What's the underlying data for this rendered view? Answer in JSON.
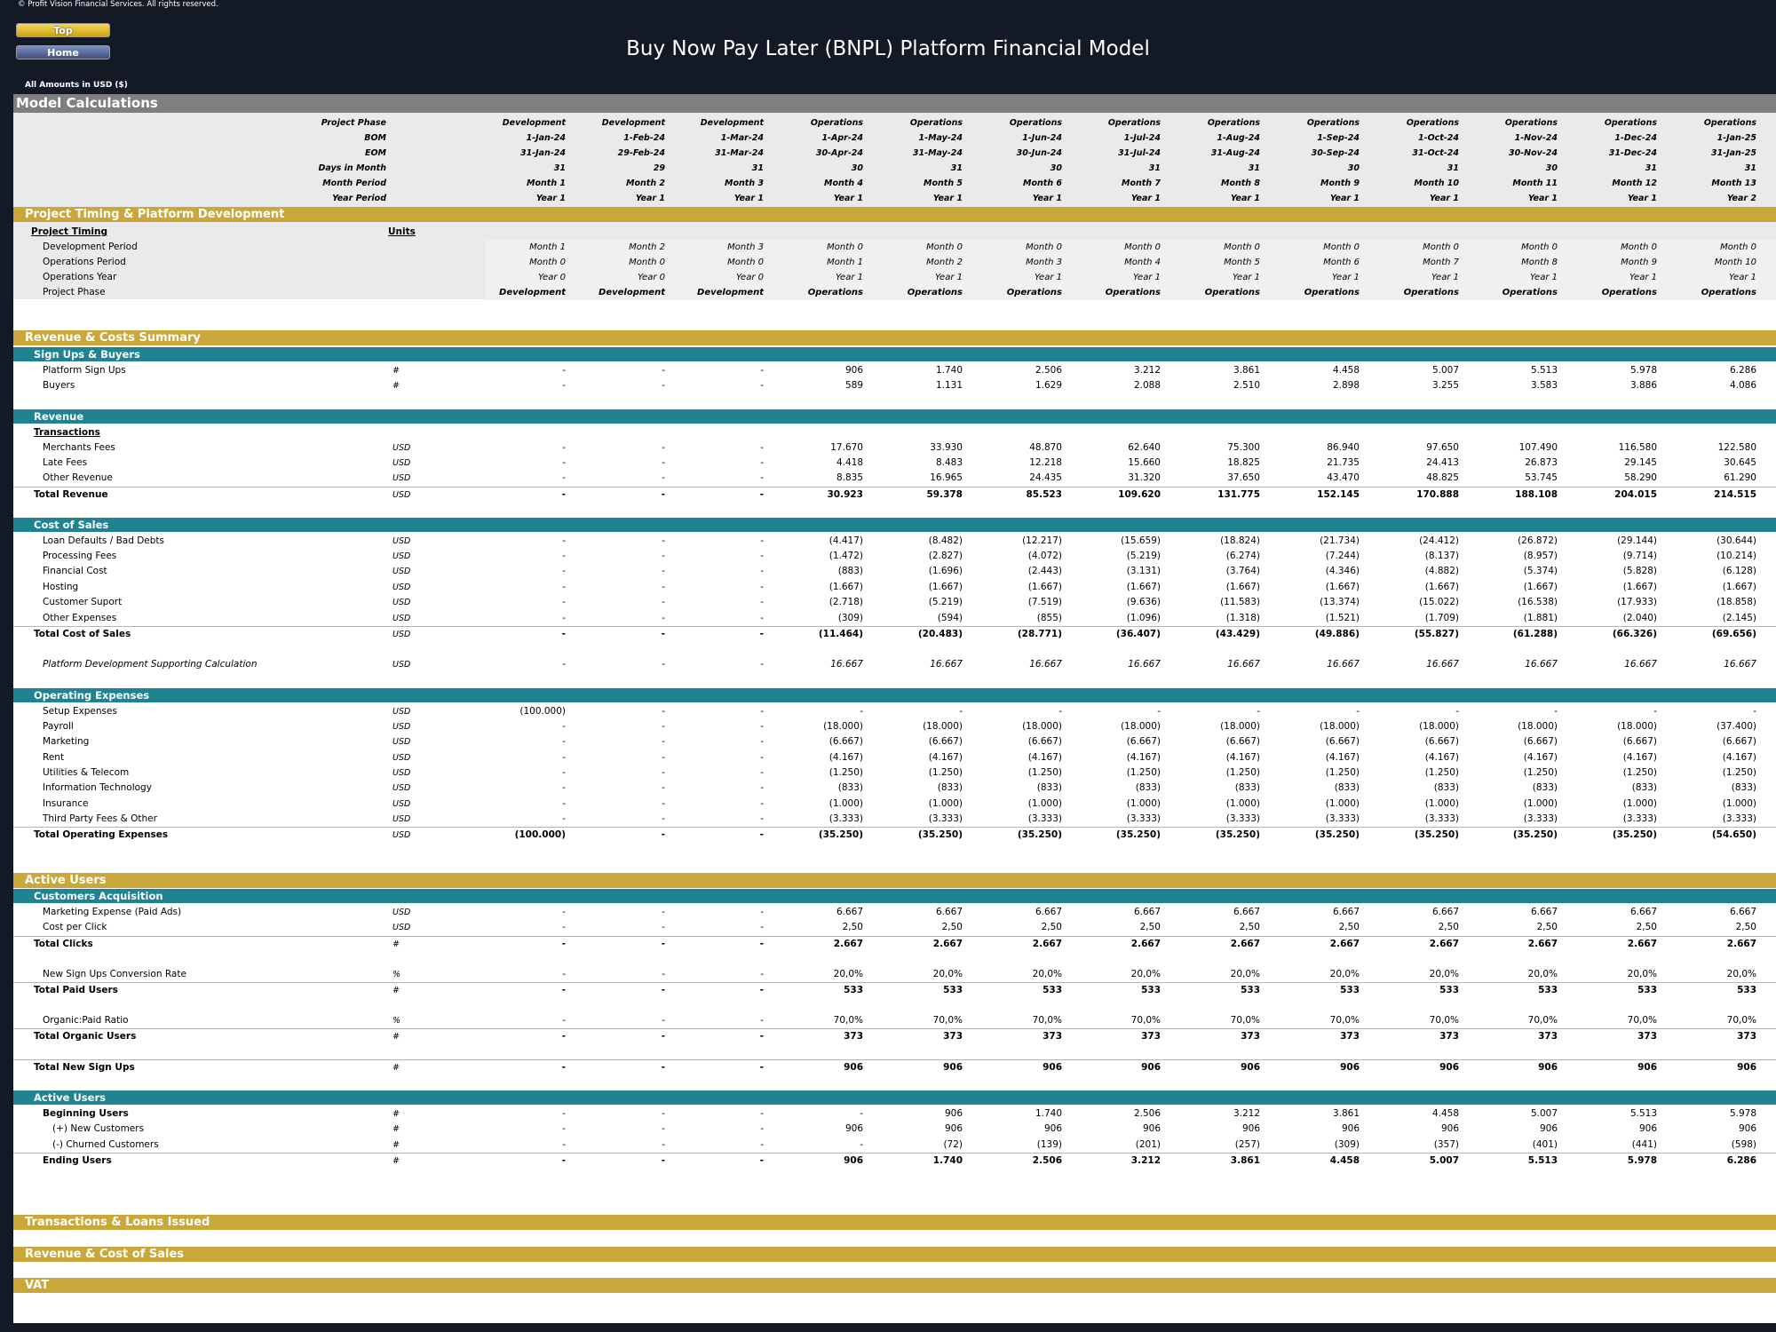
{
  "copyright": "© Profit Vision Financial Services. All rights reserved.",
  "nav": {
    "top": "Top",
    "home": "Home"
  },
  "title": "Buy Now Pay Later (BNPL) Platform Financial Model",
  "amounts": "All Amounts in  USD ($)",
  "section_title": "Model Calculations",
  "header_rows": [
    {
      "label": "Project Phase",
      "values": [
        "Development",
        "Development",
        "Development",
        "Operations",
        "Operations",
        "Operations",
        "Operations",
        "Operations",
        "Operations",
        "Operations",
        "Operations",
        "Operations",
        "Operations"
      ]
    },
    {
      "label": "BOM",
      "values": [
        "1-Jan-24",
        "1-Feb-24",
        "1-Mar-24",
        "1-Apr-24",
        "1-May-24",
        "1-Jun-24",
        "1-Jul-24",
        "1-Aug-24",
        "1-Sep-24",
        "1-Oct-24",
        "1-Nov-24",
        "1-Dec-24",
        "1-Jan-25"
      ]
    },
    {
      "label": "EOM",
      "values": [
        "31-Jan-24",
        "29-Feb-24",
        "31-Mar-24",
        "30-Apr-24",
        "31-May-24",
        "30-Jun-24",
        "31-Jul-24",
        "31-Aug-24",
        "30-Sep-24",
        "31-Oct-24",
        "30-Nov-24",
        "31-Dec-24",
        "31-Jan-25"
      ]
    },
    {
      "label": "Days in Month",
      "values": [
        "31",
        "29",
        "31",
        "30",
        "31",
        "30",
        "31",
        "31",
        "30",
        "31",
        "30",
        "31",
        "31"
      ]
    },
    {
      "label": "Month Period",
      "values": [
        "Month 1",
        "Month 2",
        "Month 3",
        "Month 4",
        "Month 5",
        "Month 6",
        "Month 7",
        "Month 8",
        "Month 9",
        "Month 10",
        "Month 11",
        "Month 12",
        "Month 13"
      ]
    },
    {
      "label": "Year Period",
      "values": [
        "Year 1",
        "Year 1",
        "Year 1",
        "Year 1",
        "Year 1",
        "Year 1",
        "Year 1",
        "Year 1",
        "Year 1",
        "Year 1",
        "Year 1",
        "Year 1",
        "Year 2"
      ]
    }
  ],
  "gold_sections": {
    "timing": "Project Timing & Platform Development",
    "summary": "Revenue & Costs Summary",
    "active": "Active Users",
    "transactions": "Transactions & Loans Issued",
    "revcost": "Revenue & Cost of Sales",
    "vat": "VAT"
  },
  "teal_sections": {
    "signups": "Sign Ups & Buyers",
    "revenue": "Revenue",
    "cos": "Cost of Sales",
    "opex": "Operating Expenses",
    "acq": "Customers Acquisition",
    "active": "Active Users"
  },
  "timing": {
    "heading": "Project Timing",
    "units_heading": "Units",
    "rows": [
      {
        "label": "Development Period",
        "values": [
          "Month 1",
          "Month 2",
          "Month 3",
          "Month 0",
          "Month 0",
          "Month 0",
          "Month 0",
          "Month 0",
          "Month 0",
          "Month 0",
          "Month 0",
          "Month 0",
          "Month 0"
        ]
      },
      {
        "label": "Operations Period",
        "values": [
          "Month 0",
          "Month 0",
          "Month 0",
          "Month 1",
          "Month 2",
          "Month 3",
          "Month 4",
          "Month 5",
          "Month 6",
          "Month 7",
          "Month 8",
          "Month 9",
          "Month 10"
        ]
      },
      {
        "label": "Operations Year",
        "values": [
          "Year 0",
          "Year 0",
          "Year 0",
          "Year 1",
          "Year 1",
          "Year 1",
          "Year 1",
          "Year 1",
          "Year 1",
          "Year 1",
          "Year 1",
          "Year 1",
          "Year 1"
        ]
      },
      {
        "label": "Project Phase",
        "values": [
          "Development",
          "Development",
          "Development",
          "Operations",
          "Operations",
          "Operations",
          "Operations",
          "Operations",
          "Operations",
          "Operations",
          "Operations",
          "Operations",
          "Operations"
        ]
      }
    ]
  },
  "signups": [
    {
      "label": "Platform Sign Ups",
      "unit": "#",
      "values": [
        "-",
        "-",
        "-",
        "906",
        "1.740",
        "2.506",
        "3.212",
        "3.861",
        "4.458",
        "5.007",
        "5.513",
        "5.978",
        "6.286"
      ]
    },
    {
      "label": "Buyers",
      "unit": "#",
      "values": [
        "-",
        "-",
        "-",
        "589",
        "1.131",
        "1.629",
        "2.088",
        "2.510",
        "2.898",
        "3.255",
        "3.583",
        "3.886",
        "4.086"
      ]
    }
  ],
  "transactions_heading": "Transactions",
  "revenue": [
    {
      "label": "Merchants Fees",
      "unit": "USD",
      "values": [
        "-",
        "-",
        "-",
        "17.670",
        "33.930",
        "48.870",
        "62.640",
        "75.300",
        "86.940",
        "97.650",
        "107.490",
        "116.580",
        "122.580"
      ]
    },
    {
      "label": "Late Fees",
      "unit": "USD",
      "values": [
        "-",
        "-",
        "-",
        "4.418",
        "8.483",
        "12.218",
        "15.660",
        "18.825",
        "21.735",
        "24.413",
        "26.873",
        "29.145",
        "30.645"
      ]
    },
    {
      "label": "Other Revenue",
      "unit": "USD",
      "values": [
        "-",
        "-",
        "-",
        "8.835",
        "16.965",
        "24.435",
        "31.320",
        "37.650",
        "43.470",
        "48.825",
        "53.745",
        "58.290",
        "61.290"
      ]
    }
  ],
  "total_revenue": {
    "label": "Total Revenue",
    "unit": "USD",
    "values": [
      "-",
      "-",
      "-",
      "30.923",
      "59.378",
      "85.523",
      "109.620",
      "131.775",
      "152.145",
      "170.888",
      "188.108",
      "204.015",
      "214.515"
    ]
  },
  "cos": [
    {
      "label": "Loan Defaults / Bad Debts",
      "unit": "USD",
      "values": [
        "-",
        "-",
        "-",
        "(4.417)",
        "(8.482)",
        "(12.217)",
        "(15.659)",
        "(18.824)",
        "(21.734)",
        "(24.412)",
        "(26.872)",
        "(29.144)",
        "(30.644)"
      ]
    },
    {
      "label": "Processing Fees",
      "unit": "USD",
      "values": [
        "-",
        "-",
        "-",
        "(1.472)",
        "(2.827)",
        "(4.072)",
        "(5.219)",
        "(6.274)",
        "(7.244)",
        "(8.137)",
        "(8.957)",
        "(9.714)",
        "(10.214)"
      ]
    },
    {
      "label": "Financial Cost",
      "unit": "USD",
      "values": [
        "-",
        "-",
        "-",
        "(883)",
        "(1.696)",
        "(2.443)",
        "(3.131)",
        "(3.764)",
        "(4.346)",
        "(4.882)",
        "(5.374)",
        "(5.828)",
        "(6.128)"
      ]
    },
    {
      "label": "Hosting",
      "unit": "USD",
      "values": [
        "-",
        "-",
        "-",
        "(1.667)",
        "(1.667)",
        "(1.667)",
        "(1.667)",
        "(1.667)",
        "(1.667)",
        "(1.667)",
        "(1.667)",
        "(1.667)",
        "(1.667)"
      ]
    },
    {
      "label": "Customer Suport",
      "unit": "USD",
      "values": [
        "-",
        "-",
        "-",
        "(2.718)",
        "(5.219)",
        "(7.519)",
        "(9.636)",
        "(11.583)",
        "(13.374)",
        "(15.022)",
        "(16.538)",
        "(17.933)",
        "(18.858)"
      ]
    },
    {
      "label": "Other Expenses",
      "unit": "USD",
      "values": [
        "-",
        "-",
        "-",
        "(309)",
        "(594)",
        "(855)",
        "(1.096)",
        "(1.318)",
        "(1.521)",
        "(1.709)",
        "(1.881)",
        "(2.040)",
        "(2.145)"
      ]
    }
  ],
  "total_cos": {
    "label": "Total Cost of Sales",
    "unit": "USD",
    "values": [
      "-",
      "-",
      "-",
      "(11.464)",
      "(20.483)",
      "(28.771)",
      "(36.407)",
      "(43.429)",
      "(49.886)",
      "(55.827)",
      "(61.288)",
      "(66.326)",
      "(69.656)"
    ]
  },
  "platform_dev": {
    "label": "Platform Development Supporting Calculation",
    "unit": "USD",
    "values": [
      "-",
      "-",
      "-",
      "16.667",
      "16.667",
      "16.667",
      "16.667",
      "16.667",
      "16.667",
      "16.667",
      "16.667",
      "16.667",
      "16.667"
    ]
  },
  "opex": [
    {
      "label": "Setup Expenses",
      "unit": "USD",
      "values": [
        "(100.000)",
        "-",
        "-",
        "-",
        "-",
        "-",
        "-",
        "-",
        "-",
        "-",
        "-",
        "-",
        "-"
      ]
    },
    {
      "label": "Payroll",
      "unit": "USD",
      "values": [
        "-",
        "-",
        "-",
        "(18.000)",
        "(18.000)",
        "(18.000)",
        "(18.000)",
        "(18.000)",
        "(18.000)",
        "(18.000)",
        "(18.000)",
        "(18.000)",
        "(37.400)"
      ]
    },
    {
      "label": "Marketing",
      "unit": "USD",
      "values": [
        "-",
        "-",
        "-",
        "(6.667)",
        "(6.667)",
        "(6.667)",
        "(6.667)",
        "(6.667)",
        "(6.667)",
        "(6.667)",
        "(6.667)",
        "(6.667)",
        "(6.667)"
      ]
    },
    {
      "label": "Rent",
      "unit": "USD",
      "values": [
        "-",
        "-",
        "-",
        "(4.167)",
        "(4.167)",
        "(4.167)",
        "(4.167)",
        "(4.167)",
        "(4.167)",
        "(4.167)",
        "(4.167)",
        "(4.167)",
        "(4.167)"
      ]
    },
    {
      "label": "Utilities & Telecom",
      "unit": "USD",
      "values": [
        "-",
        "-",
        "-",
        "(1.250)",
        "(1.250)",
        "(1.250)",
        "(1.250)",
        "(1.250)",
        "(1.250)",
        "(1.250)",
        "(1.250)",
        "(1.250)",
        "(1.250)"
      ]
    },
    {
      "label": "Information Technology",
      "unit": "USD",
      "values": [
        "-",
        "-",
        "-",
        "(833)",
        "(833)",
        "(833)",
        "(833)",
        "(833)",
        "(833)",
        "(833)",
        "(833)",
        "(833)",
        "(833)"
      ]
    },
    {
      "label": "Insurance",
      "unit": "USD",
      "values": [
        "-",
        "-",
        "-",
        "(1.000)",
        "(1.000)",
        "(1.000)",
        "(1.000)",
        "(1.000)",
        "(1.000)",
        "(1.000)",
        "(1.000)",
        "(1.000)",
        "(1.000)"
      ]
    },
    {
      "label": "Third Party Fees & Other",
      "unit": "USD",
      "values": [
        "-",
        "-",
        "-",
        "(3.333)",
        "(3.333)",
        "(3.333)",
        "(3.333)",
        "(3.333)",
        "(3.333)",
        "(3.333)",
        "(3.333)",
        "(3.333)",
        "(3.333)"
      ]
    }
  ],
  "total_opex": {
    "label": "Total Operating Expenses",
    "unit": "USD",
    "values": [
      "(100.000)",
      "-",
      "-",
      "(35.250)",
      "(35.250)",
      "(35.250)",
      "(35.250)",
      "(35.250)",
      "(35.250)",
      "(35.250)",
      "(35.250)",
      "(35.250)",
      "(54.650)"
    ]
  },
  "acq": {
    "marketing": {
      "label": "Marketing Expense (Paid Ads)",
      "unit": "USD",
      "values": [
        "-",
        "-",
        "-",
        "6.667",
        "6.667",
        "6.667",
        "6.667",
        "6.667",
        "6.667",
        "6.667",
        "6.667",
        "6.667",
        "6.667"
      ]
    },
    "cpc": {
      "label": "Cost per Click",
      "unit": "USD",
      "values": [
        "-",
        "-",
        "-",
        "2,50",
        "2,50",
        "2,50",
        "2,50",
        "2,50",
        "2,50",
        "2,50",
        "2,50",
        "2,50",
        "2,50"
      ]
    },
    "clicks": {
      "label": "Total Clicks",
      "unit": "#",
      "values": [
        "-",
        "-",
        "-",
        "2.667",
        "2.667",
        "2.667",
        "2.667",
        "2.667",
        "2.667",
        "2.667",
        "2.667",
        "2.667",
        "2.667"
      ]
    },
    "conv": {
      "label": "New Sign Ups Conversion Rate",
      "unit": "%",
      "values": [
        "-",
        "-",
        "-",
        "20,0%",
        "20,0%",
        "20,0%",
        "20,0%",
        "20,0%",
        "20,0%",
        "20,0%",
        "20,0%",
        "20,0%",
        "20,0%"
      ]
    },
    "paid": {
      "label": "Total Paid Users",
      "unit": "#",
      "values": [
        "-",
        "-",
        "-",
        "533",
        "533",
        "533",
        "533",
        "533",
        "533",
        "533",
        "533",
        "533",
        "533"
      ]
    },
    "ratio": {
      "label": "Organic:Paid Ratio",
      "unit": "%",
      "values": [
        "-",
        "-",
        "-",
        "70,0%",
        "70,0%",
        "70,0%",
        "70,0%",
        "70,0%",
        "70,0%",
        "70,0%",
        "70,0%",
        "70,0%",
        "70,0%"
      ]
    },
    "organic": {
      "label": "Total Organic Users",
      "unit": "#",
      "values": [
        "-",
        "-",
        "-",
        "373",
        "373",
        "373",
        "373",
        "373",
        "373",
        "373",
        "373",
        "373",
        "373"
      ]
    },
    "newsignups": {
      "label": "Total New Sign Ups",
      "unit": "#",
      "values": [
        "-",
        "-",
        "-",
        "906",
        "906",
        "906",
        "906",
        "906",
        "906",
        "906",
        "906",
        "906",
        "906"
      ]
    }
  },
  "active": {
    "beginning": {
      "label": "Beginning Users",
      "unit": "#",
      "values": [
        "-",
        "-",
        "-",
        "-",
        "906",
        "1.740",
        "2.506",
        "3.212",
        "3.861",
        "4.458",
        "5.007",
        "5.513",
        "5.978"
      ]
    },
    "new": {
      "label": "(+) New Customers",
      "unit": "#",
      "values": [
        "-",
        "-",
        "-",
        "906",
        "906",
        "906",
        "906",
        "906",
        "906",
        "906",
        "906",
        "906",
        "906"
      ]
    },
    "churned": {
      "label": "(-) Churned Customers",
      "unit": "#",
      "values": [
        "-",
        "-",
        "-",
        "-",
        "(72)",
        "(139)",
        "(201)",
        "(257)",
        "(309)",
        "(357)",
        "(401)",
        "(441)",
        "(598)"
      ]
    },
    "ending": {
      "label": "Ending Users",
      "unit": "#",
      "values": [
        "-",
        "-",
        "-",
        "906",
        "1.740",
        "2.506",
        "3.212",
        "3.861",
        "4.458",
        "5.007",
        "5.513",
        "5.978",
        "6.286"
      ]
    }
  }
}
